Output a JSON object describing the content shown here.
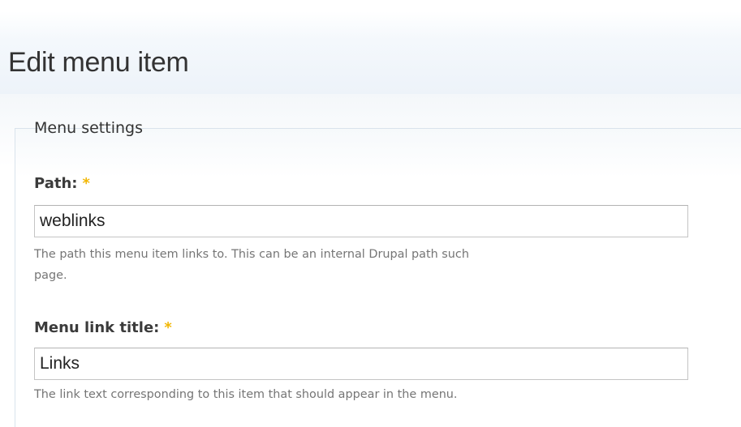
{
  "page": {
    "title": "Edit menu item"
  },
  "fieldset": {
    "legend": "Menu settings"
  },
  "fields": {
    "path": {
      "label": "Path:",
      "required_marker": "*",
      "value": "weblinks",
      "description_line1": "The path this menu item links to. This can be an internal Drupal path such",
      "description_line2": "page."
    },
    "menu_link_title": {
      "label": "Menu link title:",
      "required_marker": "*",
      "value": "Links",
      "description": "The link text corresponding to this item that should appear in the menu."
    }
  },
  "colors": {
    "required_star": "#f2b705",
    "header_gradient_end": "#edf3f9",
    "label_text": "#3b3b3b",
    "description_text": "#757575"
  }
}
